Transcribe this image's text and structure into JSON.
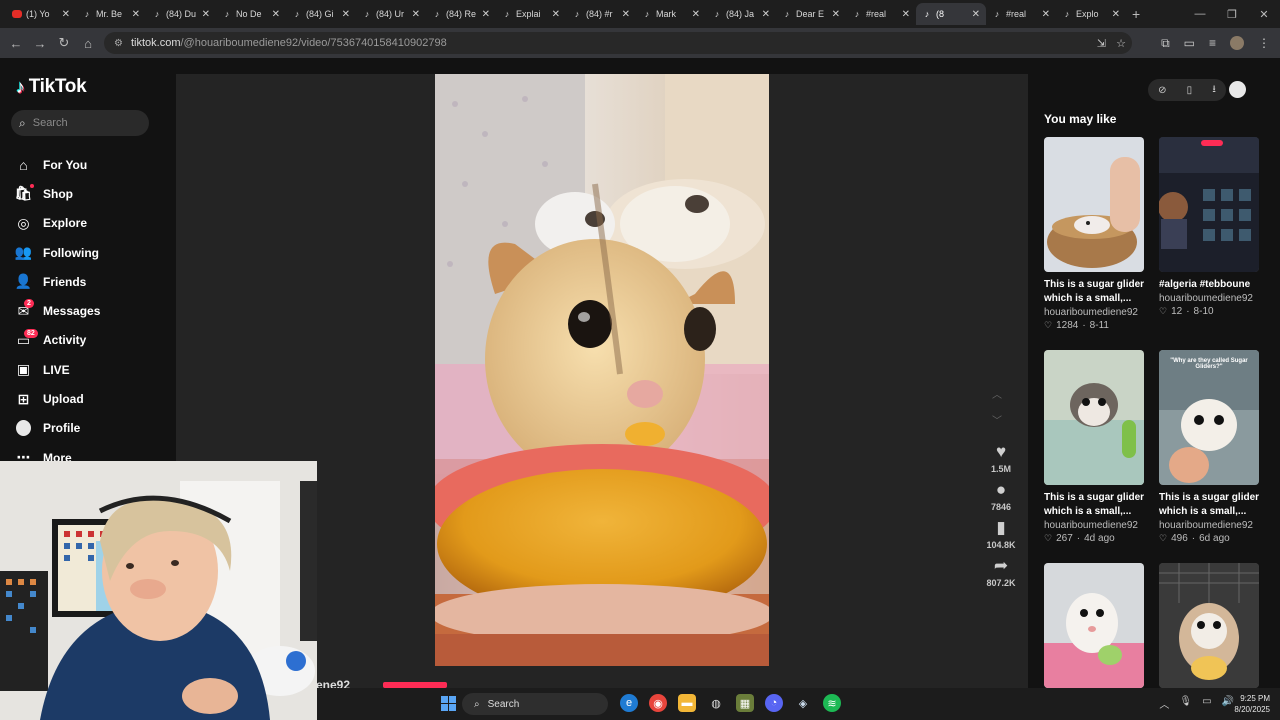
{
  "browser": {
    "tabs": [
      {
        "label": "(1) Yo",
        "favicon": "youtube"
      },
      {
        "label": "Mr. Be",
        "favicon": "tiktok"
      },
      {
        "label": "(84) Du",
        "favicon": "tiktok"
      },
      {
        "label": "No De",
        "favicon": "tiktok"
      },
      {
        "label": "(84) Gi",
        "favicon": "tiktok"
      },
      {
        "label": "(84) Ur",
        "favicon": "tiktok"
      },
      {
        "label": "(84) Re",
        "favicon": "tiktok"
      },
      {
        "label": "Explai",
        "favicon": "tiktok"
      },
      {
        "label": "(84) #r",
        "favicon": "tiktok"
      },
      {
        "label": "Mark",
        "favicon": "tiktok"
      },
      {
        "label": "(84) Ja",
        "favicon": "tiktok"
      },
      {
        "label": "Dear E",
        "favicon": "tiktok"
      },
      {
        "label": "#real",
        "favicon": "tiktok"
      },
      {
        "label": "(8",
        "favicon": "tiktok",
        "active": true
      },
      {
        "label": "#real",
        "favicon": "tiktok"
      },
      {
        "label": "Explo",
        "favicon": "tiktok"
      }
    ],
    "url_host": "tiktok.com",
    "url_path": "/@houariboumediene92/video/7536740158410902798"
  },
  "tiktok": {
    "logo_text": "TikTok",
    "search_placeholder": "Search",
    "nav": [
      {
        "label": "For You",
        "icon": "home-icon",
        "glyph": "⌂"
      },
      {
        "label": "Shop",
        "icon": "shop-icon",
        "glyph": "🛍",
        "dot": true
      },
      {
        "label": "Explore",
        "icon": "compass-icon",
        "glyph": "◎"
      },
      {
        "label": "Following",
        "icon": "following-icon",
        "glyph": "👥"
      },
      {
        "label": "Friends",
        "icon": "friends-icon",
        "glyph": "👤"
      },
      {
        "label": "Messages",
        "icon": "messages-icon",
        "glyph": "✉",
        "badge": "2"
      },
      {
        "label": "Activity",
        "icon": "activity-icon",
        "glyph": "▭",
        "badge": "82"
      },
      {
        "label": "LIVE",
        "icon": "live-icon",
        "glyph": "▣"
      },
      {
        "label": "Upload",
        "icon": "upload-icon",
        "glyph": "⊞"
      },
      {
        "label": "Profile",
        "icon": "profile-icon",
        "glyph": ""
      },
      {
        "label": "More",
        "icon": "more-icon",
        "glyph": "⋯"
      }
    ],
    "video_author_partial": "ene92",
    "actions": [
      {
        "icon": "heart-icon",
        "glyph": "♥",
        "count": "1.5M"
      },
      {
        "icon": "comment-icon",
        "glyph": "●",
        "count": "7846"
      },
      {
        "icon": "bookmark-icon",
        "glyph": "▮",
        "count": "104.8K"
      },
      {
        "icon": "share-icon",
        "glyph": "➦",
        "count": "807.2K"
      }
    ],
    "you_may_like_title": "You may like",
    "cards": [
      {
        "title": "This is a sugar glider which is a small,...",
        "user": "houariboumediene92",
        "likes": "1284",
        "date": "8-11"
      },
      {
        "title": "#algeria #tebboune",
        "user": "houariboumediene92",
        "likes": "12",
        "date": "8-10"
      },
      {
        "title": "This is a sugar glider which is a small,...",
        "user": "houariboumediene92",
        "likes": "267",
        "date": "4d ago"
      },
      {
        "title": "This is a sugar glider which is a small,...",
        "user": "houariboumediene92",
        "likes": "496",
        "date": "6d ago"
      },
      {
        "title": "",
        "user": "",
        "likes": "",
        "date": ""
      },
      {
        "title": "",
        "user": "",
        "likes": "",
        "date": ""
      }
    ],
    "card_overlay_text": "\"Why are they called Sugar Gliders?\""
  },
  "taskbar": {
    "search_label": "Search",
    "time": "9:25 PM",
    "date": "8/20/2025"
  },
  "colors": {
    "accent": "#fe2c55",
    "background": "#121212",
    "stage": "#242424"
  }
}
